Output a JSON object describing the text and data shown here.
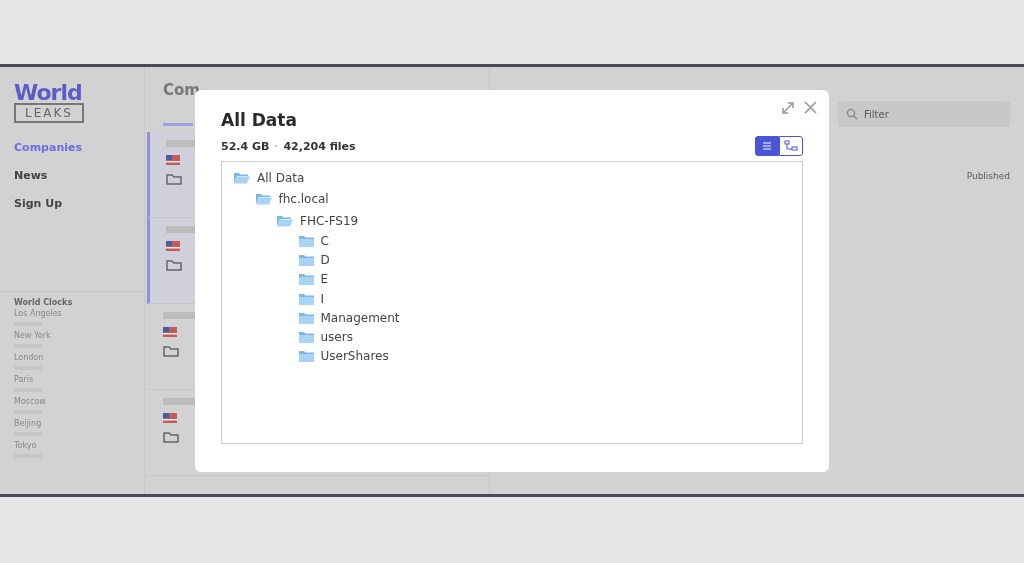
{
  "app": {
    "logo": {
      "top": "World",
      "bottom": "LEAKS"
    },
    "nav": [
      {
        "label": "Companies",
        "selected": true
      },
      {
        "label": "News",
        "selected": false
      },
      {
        "label": "Sign Up",
        "selected": false
      }
    ],
    "clocks": {
      "title": "World Clocks",
      "cities": [
        "Los Angeles",
        "New York",
        "London",
        "Paris",
        "Moscow",
        "Beijing",
        "Tokyo"
      ]
    },
    "heading": "Com",
    "filter": {
      "placeholder": "Filter"
    },
    "published_label": "Published"
  },
  "dialog": {
    "title": "All Data",
    "size": "52.4 GB",
    "files": "42,204 files",
    "views": [
      {
        "kind": "list",
        "selected": true
      },
      {
        "kind": "tree",
        "selected": false
      }
    ],
    "tree": [
      {
        "name": "All Data",
        "expanded": true,
        "children": [
          {
            "name": "fhc.local",
            "expanded": true,
            "children": [
              {
                "name": "FHC-FS19",
                "expanded": true,
                "children": [
                  {
                    "name": "C",
                    "expanded": false
                  },
                  {
                    "name": "D",
                    "expanded": false
                  },
                  {
                    "name": "E",
                    "expanded": false
                  },
                  {
                    "name": "I",
                    "expanded": false
                  },
                  {
                    "name": "Management",
                    "expanded": false
                  },
                  {
                    "name": "users",
                    "expanded": false
                  },
                  {
                    "name": "UserShares",
                    "expanded": false
                  }
                ]
              }
            ]
          }
        ]
      }
    ]
  }
}
